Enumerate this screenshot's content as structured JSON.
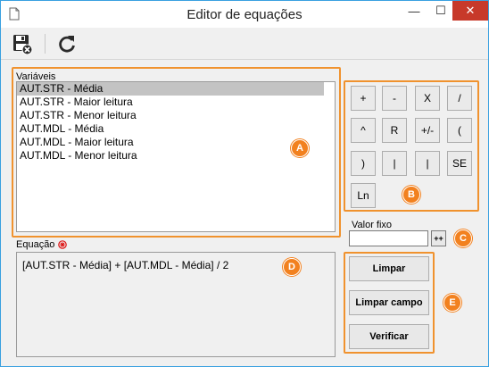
{
  "window": {
    "title": "Editor de equações",
    "minimize": "—",
    "maximize": "☐",
    "close": "✕"
  },
  "toolbar": {
    "save_icon": "save-cancel-icon",
    "refresh_icon": "refresh-icon"
  },
  "variables": {
    "label": "Variáveis",
    "items": [
      "AUT.STR - Média",
      "AUT.STR - Maior leitura",
      "AUT.STR - Menor leitura",
      "AUT.MDL - Média",
      "AUT.MDL - Maior leitura",
      "AUT.MDL - Menor leitura"
    ],
    "selected_index": 0
  },
  "operators": [
    "+",
    "-",
    "X",
    "/",
    "^",
    "R",
    "+/-",
    "(",
    ")",
    "|",
    "|",
    "SE",
    "Ln"
  ],
  "fixed_value": {
    "label": "Valor fixo",
    "value": "",
    "button": "++"
  },
  "equation": {
    "label": "Equação",
    "value": "[AUT.STR - Média] + [AUT.MDL - Média] / 2"
  },
  "actions": {
    "clear": "Limpar",
    "clear_field": "Limpar campo",
    "verify": "Verificar"
  },
  "annotations": {
    "a": "A",
    "b": "B",
    "c": "C",
    "d": "D",
    "e": "E",
    "color": "#f2811f"
  }
}
